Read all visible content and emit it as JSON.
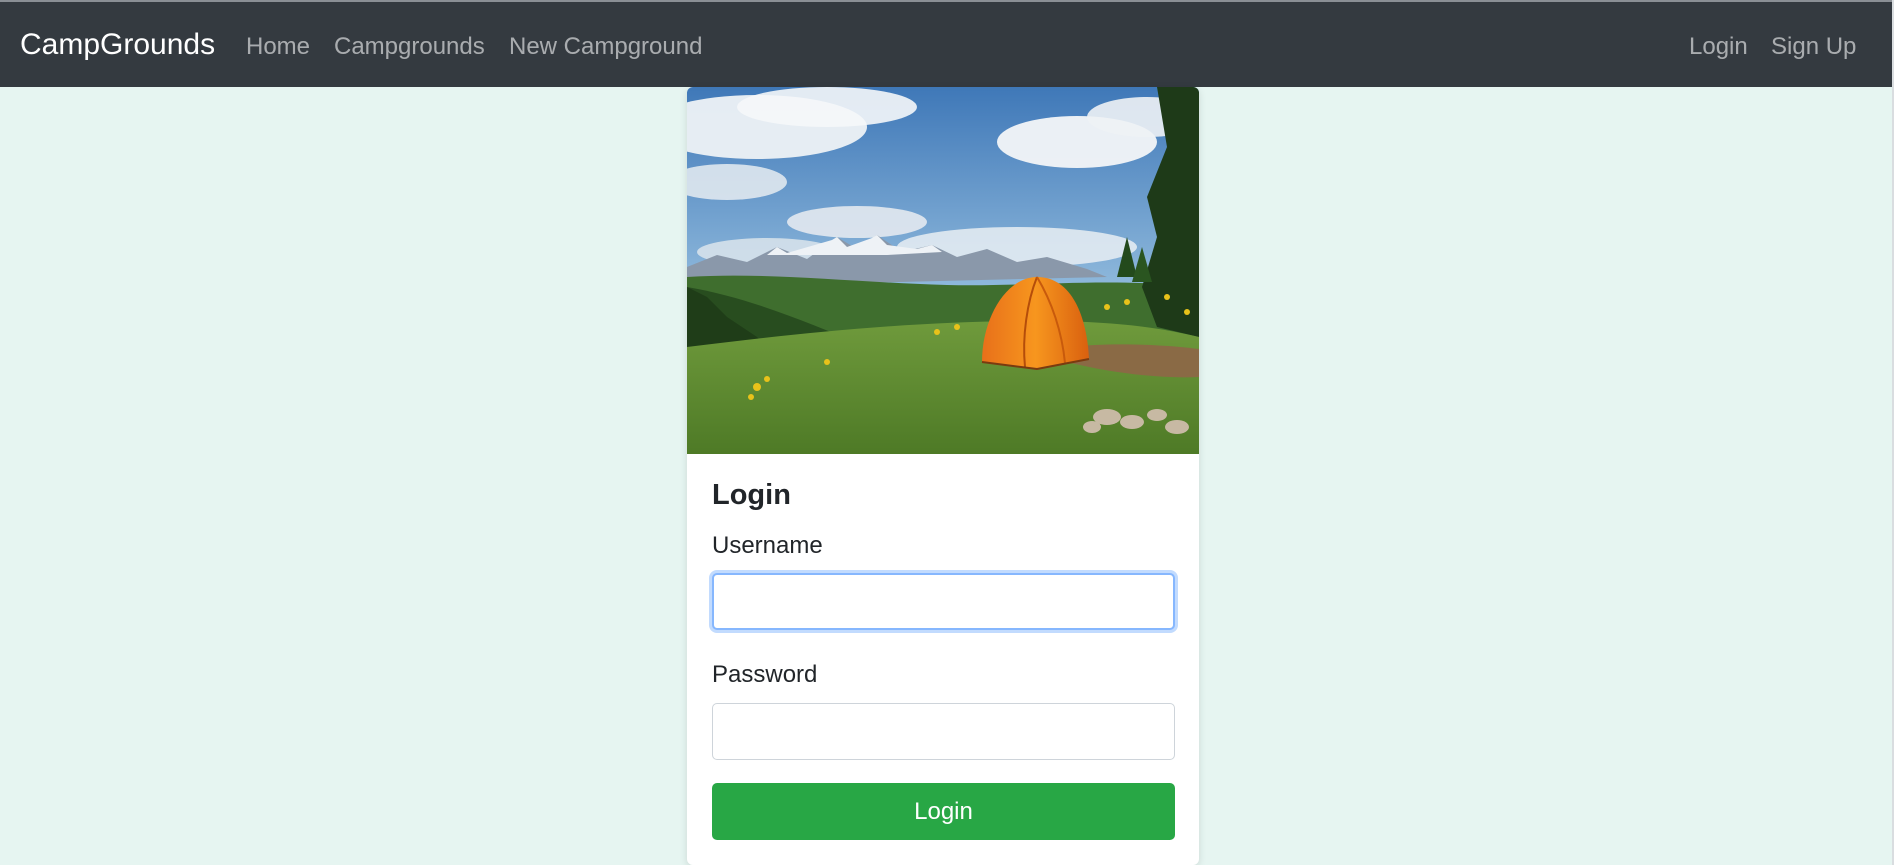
{
  "navbar": {
    "brand": "CampGrounds",
    "links": [
      {
        "label": "Home"
      },
      {
        "label": "Campgrounds"
      },
      {
        "label": "New Campground"
      }
    ],
    "auth_links": [
      {
        "label": "Login"
      },
      {
        "label": "Sign Up"
      }
    ]
  },
  "card": {
    "image_icon": "campsite-photo",
    "title": "Login",
    "username": {
      "label": "Username",
      "value": ""
    },
    "password": {
      "label": "Password",
      "value": ""
    },
    "submit_label": "Login"
  },
  "colors": {
    "navbar": "#343a40",
    "page_background": "#e6f5f1",
    "button": "#28a745",
    "focus_ring": "#86b7fe"
  }
}
